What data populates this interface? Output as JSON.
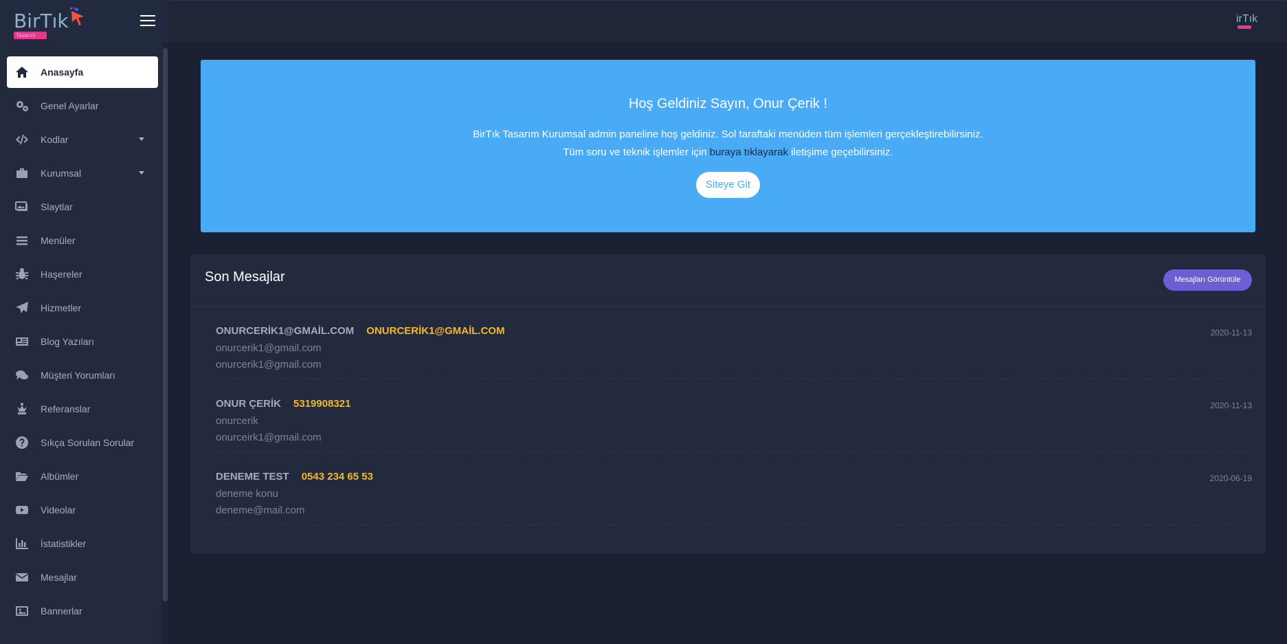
{
  "brand": {
    "logo_text": "BirTık",
    "logo_sub": "Tasarım",
    "user_logo_text": "irTık"
  },
  "sidebar": {
    "items": [
      {
        "label": "Anasayfa",
        "icon": "home-icon",
        "active": true
      },
      {
        "label": "Genel Ayarlar",
        "icon": "cogs-icon"
      },
      {
        "label": "Kodlar",
        "icon": "code-icon",
        "dropdown": true
      },
      {
        "label": "Kurumsal",
        "icon": "briefcase-icon",
        "dropdown": true
      },
      {
        "label": "Slaytlar",
        "icon": "images-icon"
      },
      {
        "label": "Menüler",
        "icon": "bars-icon"
      },
      {
        "label": "Haşereler",
        "icon": "bug-icon"
      },
      {
        "label": "Hizmetler",
        "icon": "paper-plane-icon"
      },
      {
        "label": "Blog Yazıları",
        "icon": "newspaper-icon"
      },
      {
        "label": "Müşteri Yorumları",
        "icon": "comments-icon"
      },
      {
        "label": "Referanslar",
        "icon": "chess-queen-icon"
      },
      {
        "label": "Sıkça Sorulan Sorular",
        "icon": "question-circle-icon"
      },
      {
        "label": "Albümler",
        "icon": "folder-open-icon"
      },
      {
        "label": "Videolar",
        "icon": "youtube-icon"
      },
      {
        "label": "İstatistikler",
        "icon": "chart-bar-icon"
      },
      {
        "label": "Mesajlar",
        "icon": "envelope-icon"
      },
      {
        "label": "Bannerlar",
        "icon": "image-icon"
      }
    ]
  },
  "welcome": {
    "title": "Hoş Geldiniz Sayın, Onur Çerik !",
    "line1": "BirTık Tasarım Kurumsal admin paneline hoş geldiniz. Sol taraftaki menüden tüm işlemleri gerçekleştirebilirsiniz.",
    "line2_before": "Tüm soru ve teknik işlemler için ",
    "line2_link": "buraya tıklayarak",
    "line2_after": " iletişime geçebilirsiniz.",
    "button": "Siteye Git"
  },
  "messages": {
    "title": "Son Mesajlar",
    "view_button": "Mesajları Görüntüle",
    "items": [
      {
        "name": "ONURCERİK1@GMAİL.COM",
        "phone": "ONURCERİK1@GMAİL.COM",
        "subject": "onurcerik1@gmail.com",
        "email": "onurcerik1@gmail.com",
        "date": "2020-11-13"
      },
      {
        "name": "ONUR ÇERİK",
        "phone": "5319908321",
        "subject": "onurcerik",
        "email": "onurceirk1@gmail.com",
        "date": "2020-11-13"
      },
      {
        "name": "DENEME TEST",
        "phone": "0543 234 65 53",
        "subject": "deneme konu",
        "email": "deneme@mail.com",
        "date": "2020-06-19"
      }
    ]
  },
  "colors": {
    "background": "#1b2033",
    "sidebar": "#232a3d",
    "banner": "#49aaf5",
    "accent_button": "#6c5fd1",
    "phone_highlight": "#f4b82b"
  }
}
